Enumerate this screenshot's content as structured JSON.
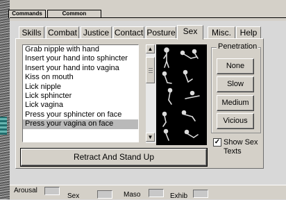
{
  "top_tabs": [
    "Commands",
    "Common"
  ],
  "tabs": [
    "Skills",
    "Combat",
    "Justice",
    "Contact",
    "Posture",
    "Sex",
    "Misc.",
    "Help"
  ],
  "active_tab": "Sex",
  "actions": {
    "items": [
      "Grab nipple with hand",
      "Insert your hand into sphincter",
      "Insert your hand into vagina",
      "Kiss on mouth",
      "Lick nipple",
      "Lick sphincter",
      "Lick vagina",
      "Press your sphincter on face",
      "Press your vagina on face"
    ],
    "selected_index": 8
  },
  "pose_icons": [
    "pose-standing-icon",
    "pose-lying-icon",
    "pose-kneeling-icon",
    "pose-crouching-icon",
    "pose-bending-icon",
    "pose-reclining-icon"
  ],
  "penetration": {
    "title": "Penetration",
    "options": [
      "None",
      "Slow",
      "Medium",
      "Vicious"
    ]
  },
  "retract_button": "Retract And Stand Up",
  "show_texts": {
    "label": "Show Sex Texts",
    "checked": true,
    "check_glyph": "✓"
  },
  "status_bar": [
    "Arousal",
    "Sex",
    "Maso",
    "Exhib"
  ],
  "colors": {
    "panel": "#d4d0c8",
    "selection": "#b9b9b9",
    "pose_bg": "#000000"
  }
}
